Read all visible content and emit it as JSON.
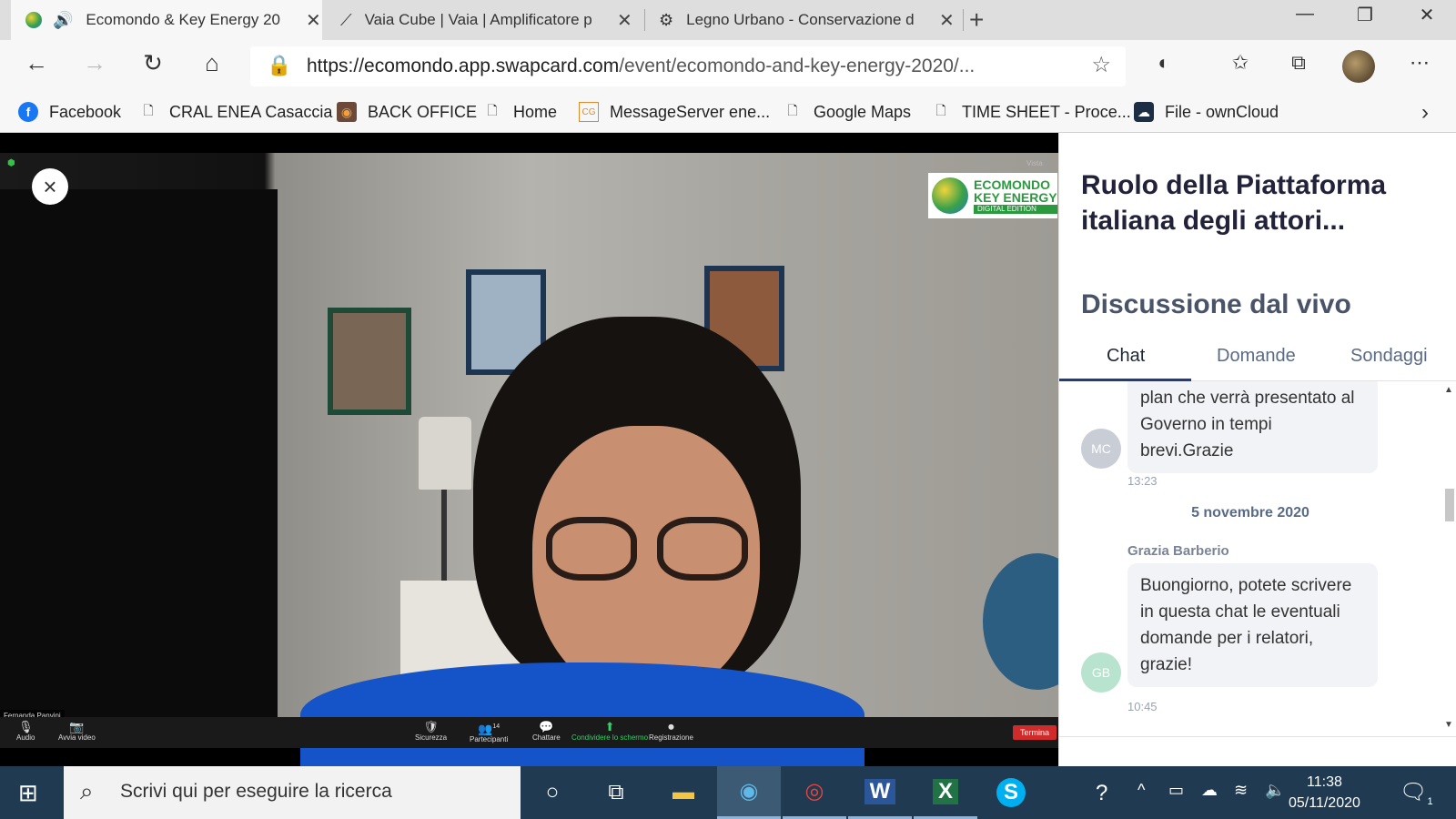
{
  "browser": {
    "tabs": [
      {
        "title": "Ecomondo & Key Energy 20",
        "active": true
      },
      {
        "title": "Vaia Cube | Vaia | Amplificatore p",
        "active": false
      },
      {
        "title": "Legno Urbano - Conservazione d",
        "active": false
      }
    ],
    "url_host": "https://ecomondo.app.swapcard.com",
    "url_path": "/event/ecomondo-and-key-energy-2020/...",
    "bookmarks": [
      "Facebook",
      "CRAL ENEA Casaccia",
      "BACK OFFICE",
      "Home",
      "MessageServer ene...",
      "Google Maps",
      "TIME SHEET - Proce...",
      "File - ownCloud"
    ]
  },
  "video": {
    "logo_line1": "ECOMONDO",
    "logo_line2": "KEY ENERGY",
    "logo_line3": "DIGITAL EDITION",
    "view_label": "Vista",
    "participant_name": "Fernanda Panvini",
    "controls": {
      "audio": "Audio",
      "video": "Avvia video",
      "security": "Sicurezza",
      "participants": "Partecipanti",
      "participants_count": "14",
      "chat": "Chattare",
      "share": "Condividere lo schermo",
      "record": "Registrazione",
      "end": "Termina"
    }
  },
  "panel": {
    "session_title": "Ruolo della Piattaforma italiana degli attori...",
    "section_title": "Discussione dal vivo",
    "tabs": [
      "Chat",
      "Domande",
      "Sondaggi"
    ],
    "messages": [
      {
        "initials": "MC",
        "text": "plan che verrà presentato al Governo in tempi brevi.Grazie",
        "time": "13:23",
        "avatar_color": "#c9cdd6"
      },
      {
        "author": "Grazia Barberio",
        "initials": "GB",
        "text": "Buongiorno, potete scrivere in questa chat le eventuali domande per i relatori, grazie!",
        "time": "10:45",
        "avatar_color": "#b7e3cf"
      }
    ],
    "date_separator": "5 novembre 2020"
  },
  "taskbar": {
    "search_placeholder": "Scrivi qui per eseguire la ricerca",
    "time": "11:38",
    "date": "05/11/2020",
    "notification_count": "1"
  }
}
